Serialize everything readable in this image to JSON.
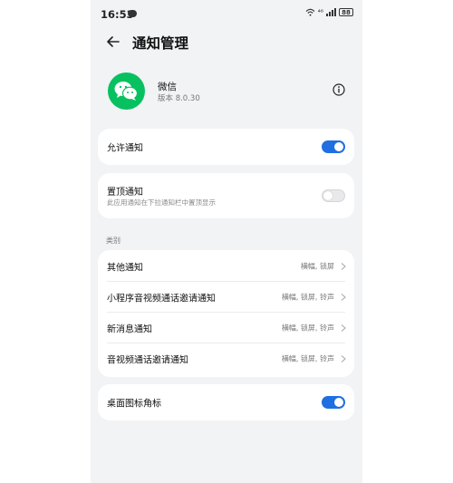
{
  "status_bar": {
    "time": "16:53",
    "network_label": "⁴⁶",
    "battery": "88"
  },
  "header": {
    "title": "通知管理"
  },
  "app": {
    "name": "微信",
    "version": "版本 8.0.30"
  },
  "allow_notifications": {
    "label": "允许通知",
    "enabled": true
  },
  "pinned_notifications": {
    "label": "置顶通知",
    "description": "此应用通知在下拉通知栏中置顶显示",
    "enabled": false
  },
  "categories": {
    "section_label": "类别",
    "items": [
      {
        "label": "其他通知",
        "value": "横幅, 锁屏"
      },
      {
        "label": "小程序音视频通话邀请通知",
        "value": "横幅, 锁屏, 铃声"
      },
      {
        "label": "新消息通知",
        "value": "横幅, 锁屏, 铃声"
      },
      {
        "label": "音视频通话邀请通知",
        "value": "横幅, 锁屏, 铃声"
      }
    ]
  },
  "desktop_badge": {
    "label": "桌面图标角标",
    "enabled": true
  },
  "colors": {
    "accent": "#1f6fe0",
    "wechat_green": "#07c160",
    "background": "#f1f3f5"
  }
}
